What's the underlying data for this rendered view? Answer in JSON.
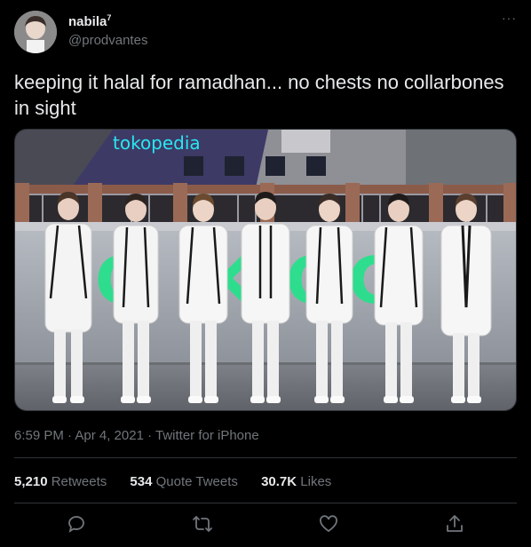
{
  "author": {
    "display_name": "nabila",
    "name_superscript": "7",
    "handle": "@prodvantes",
    "more_icon": "more-horizontal-icon"
  },
  "tweet": {
    "text": "keeping it halal for ramadhan... no chests no collarbones in sight",
    "media_sign": "tokopedia",
    "media_backdrop_letters": [
      "O",
      "K",
      "O",
      "C"
    ]
  },
  "meta": {
    "timestamp": "6:59 PM · Apr 4, 2021 · Twitter for iPhone"
  },
  "stats": {
    "retweets_count": "5,210",
    "retweets_label": "Retweets",
    "quotes_count": "534",
    "quotes_label": "Quote Tweets",
    "likes_count": "30.7K",
    "likes_label": "Likes"
  },
  "actions": [
    "reply-icon",
    "retweet-icon",
    "like-icon",
    "share-icon"
  ],
  "colors": {
    "background": "#000000",
    "text_primary": "#e7e9ea",
    "text_secondary": "#71767b",
    "divider": "#2f3336",
    "sign_cyan": "#28e7f0"
  }
}
